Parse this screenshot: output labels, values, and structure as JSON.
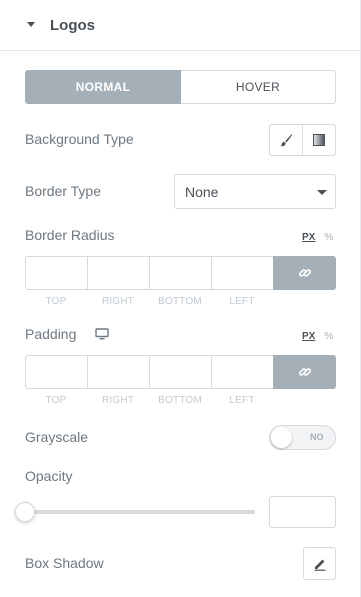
{
  "section": {
    "title": "Logos",
    "icon": "caret-down-icon"
  },
  "tabs": [
    {
      "label": "NORMAL",
      "active": true
    },
    {
      "label": "HOVER",
      "active": false
    }
  ],
  "background_type": {
    "label": "Background Type",
    "options": [
      {
        "icon": "paint-brush-icon"
      },
      {
        "icon": "gradient-icon"
      }
    ]
  },
  "border_type": {
    "label": "Border Type",
    "value": "None"
  },
  "border_radius": {
    "label": "Border Radius",
    "units": {
      "px": "PX",
      "percent": "%"
    },
    "sides": [
      "TOP",
      "RIGHT",
      "BOTTOM",
      "LEFT"
    ],
    "link_icon": "link-icon"
  },
  "padding": {
    "label": "Padding",
    "device_icon": "desktop-icon",
    "units": {
      "px": "PX",
      "percent": "%"
    },
    "sides": [
      "TOP",
      "RIGHT",
      "BOTTOM",
      "LEFT"
    ],
    "link_icon": "link-icon"
  },
  "grayscale": {
    "label": "Grayscale",
    "toggle_text": "NO",
    "value": false
  },
  "opacity": {
    "label": "Opacity",
    "slider_value": 0,
    "input_value": ""
  },
  "box_shadow": {
    "label": "Box Shadow",
    "icon": "pencil-icon"
  },
  "colors": {
    "active_tab": "#a4afb7",
    "border": "#d5dadf",
    "heading": "#495157",
    "label": "#6d7882",
    "muted": "#c2cbd2"
  }
}
